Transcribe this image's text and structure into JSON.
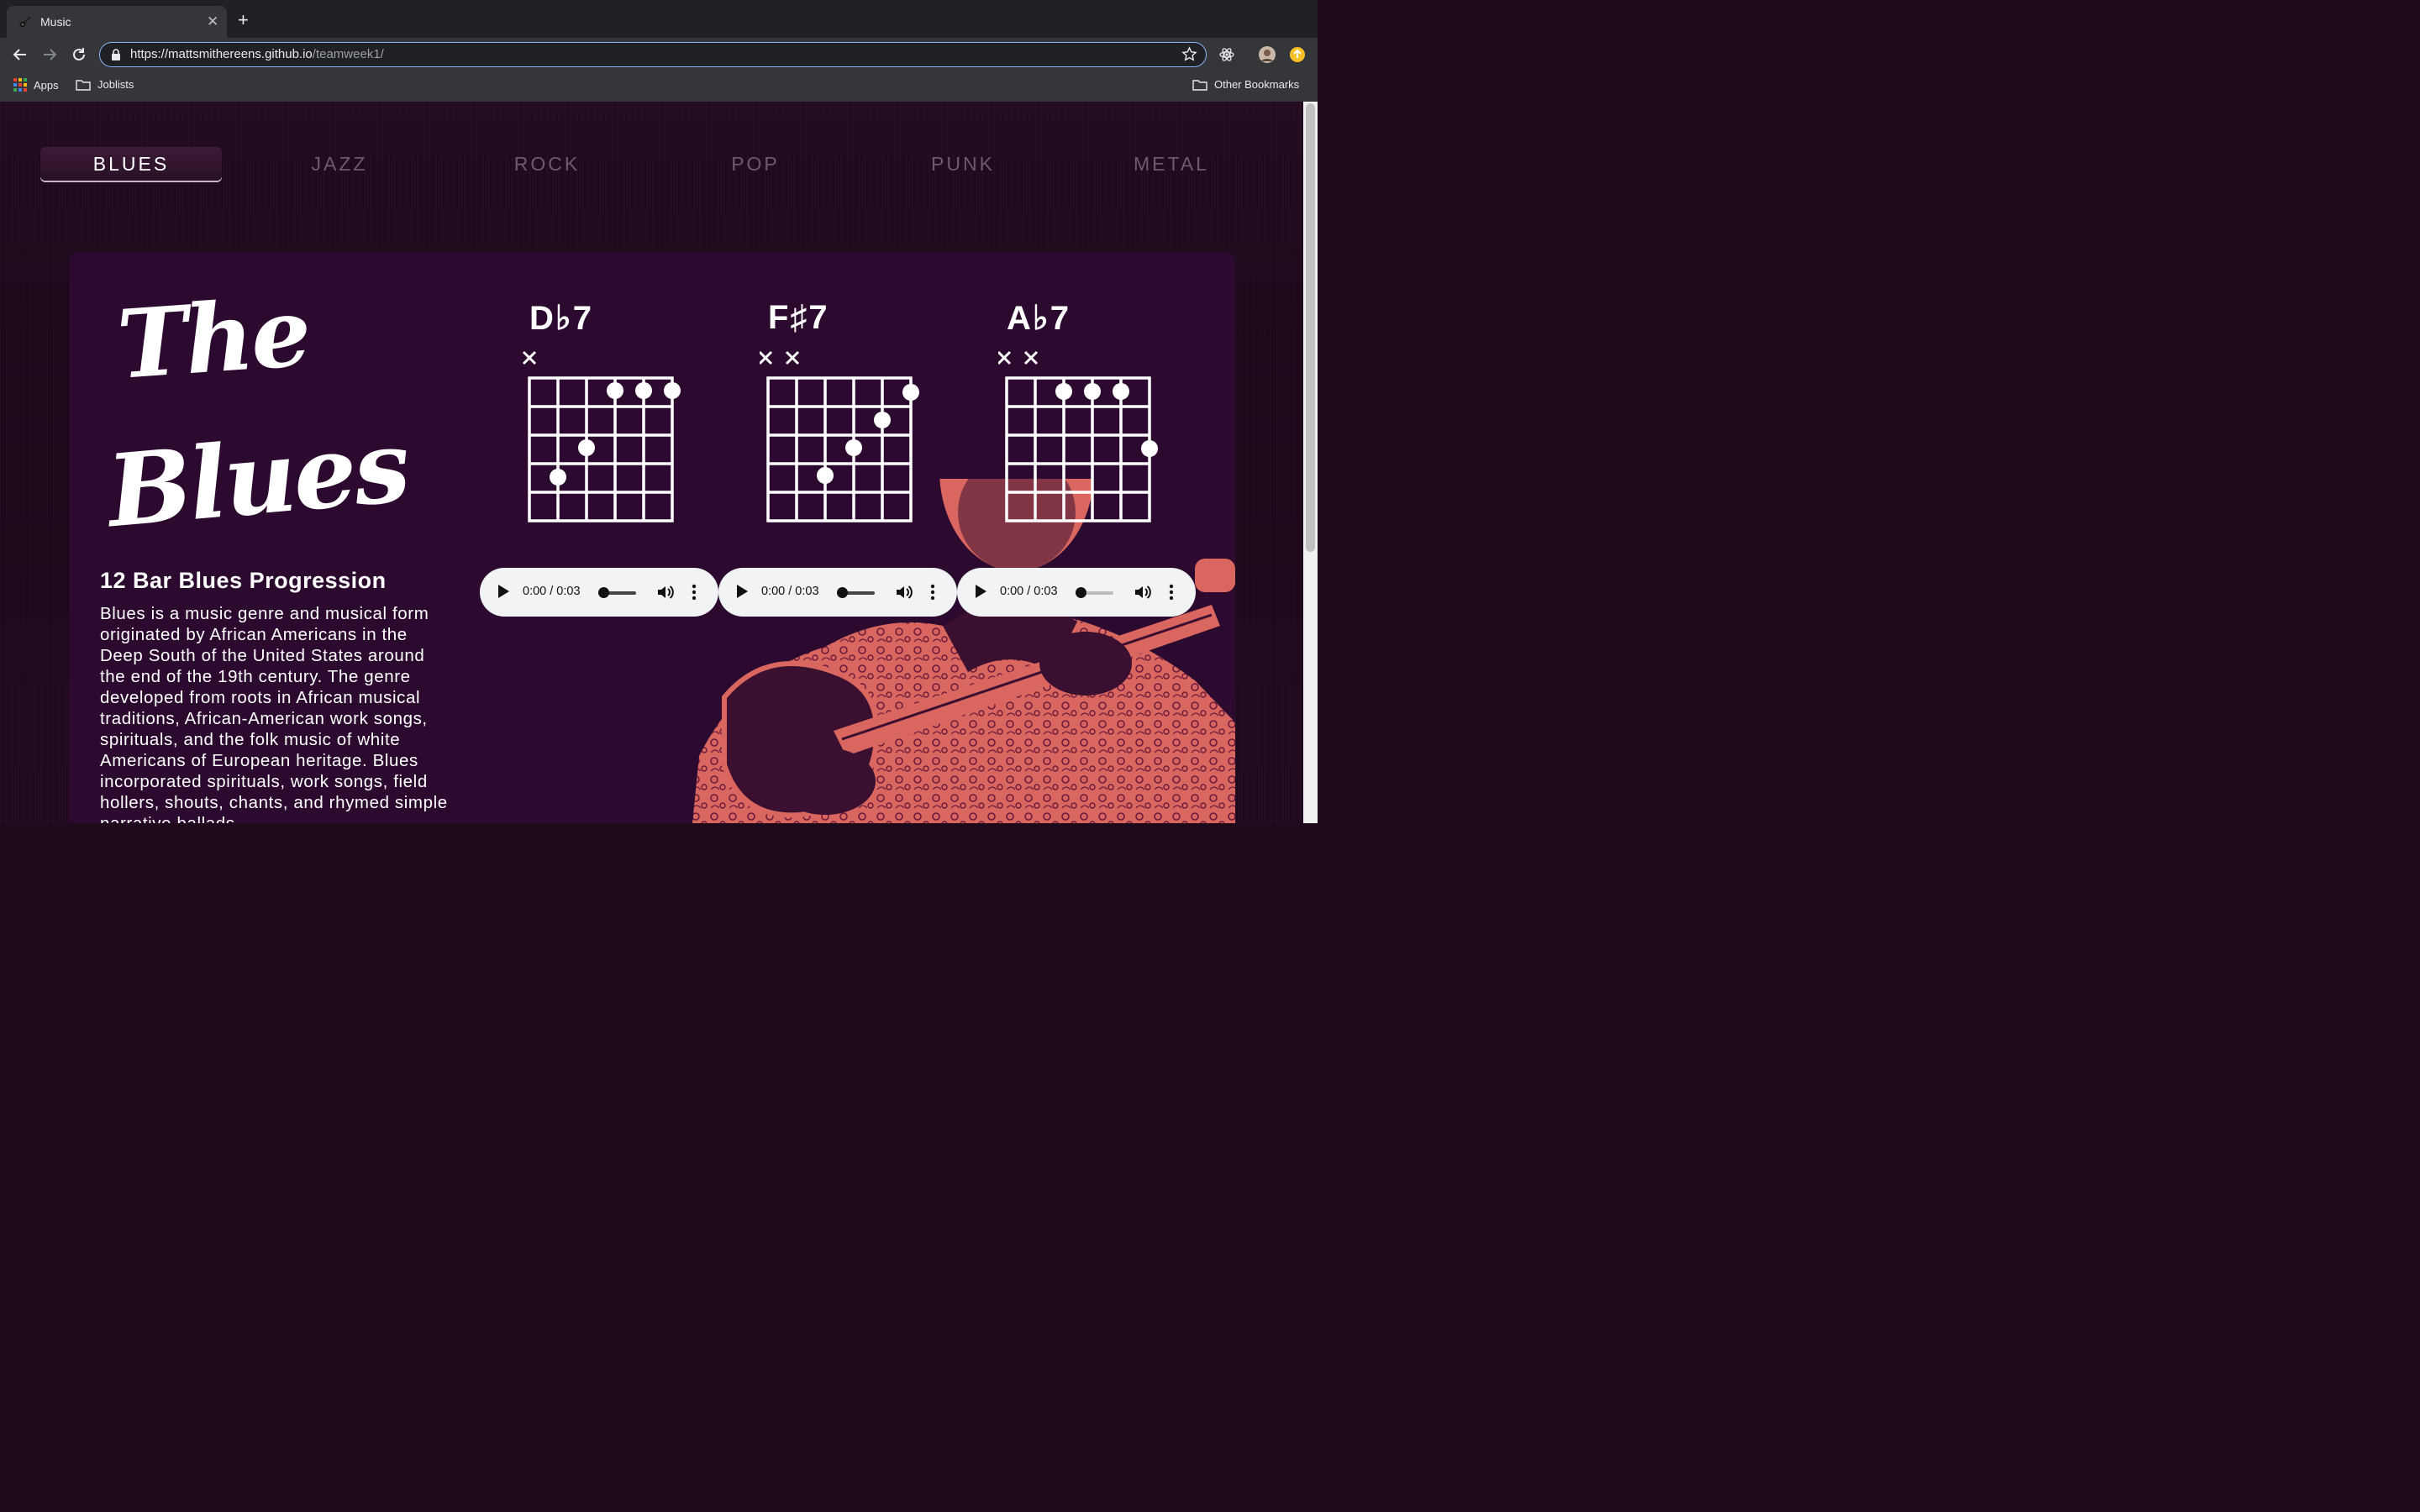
{
  "browser": {
    "tab_title": "Music",
    "tab_close": "✕",
    "new_tab": "+",
    "url_host": "https://mattsmithereens.github.io",
    "url_path": "/teamweek1/",
    "bookmarks": {
      "apps": "Apps",
      "joblists": "Joblists",
      "other": "Other Bookmarks"
    }
  },
  "nav": {
    "genres": [
      "BLUES",
      "JAZZ",
      "ROCK",
      "POP",
      "PUNK",
      "METAL"
    ],
    "active": "BLUES"
  },
  "hero": {
    "title_line1": "The",
    "title_line2": "Blues",
    "subtitle": "12 Bar Blues Progression",
    "description": "Blues is a music genre and musical form originated by African Americans in the Deep South of the United States around the end of the 19th century. The genre developed from roots in African musical traditions, African-American work songs, spirituals, and the folk music of white Americans of European heritage. Blues incorporated spirituals, work songs, field hollers, shouts, chants, and rhymed simple narrative ballads."
  },
  "chords": [
    {
      "name": "D♭7",
      "muted_marker": "✕",
      "player_time": "0:00 / 0:03"
    },
    {
      "name": "F♯7",
      "muted_marker": "✕ ✕",
      "player_time": "0:00 / 0:03"
    },
    {
      "name": "A♭7",
      "muted_marker": "✕ ✕",
      "player_time": "0:00 / 0:03"
    }
  ],
  "colors": {
    "page_bg": "#1f0a1c",
    "card_bg": "#2c0a30",
    "photo_tint": "#d9675f",
    "nav_inactive": "#6e5a6d"
  }
}
